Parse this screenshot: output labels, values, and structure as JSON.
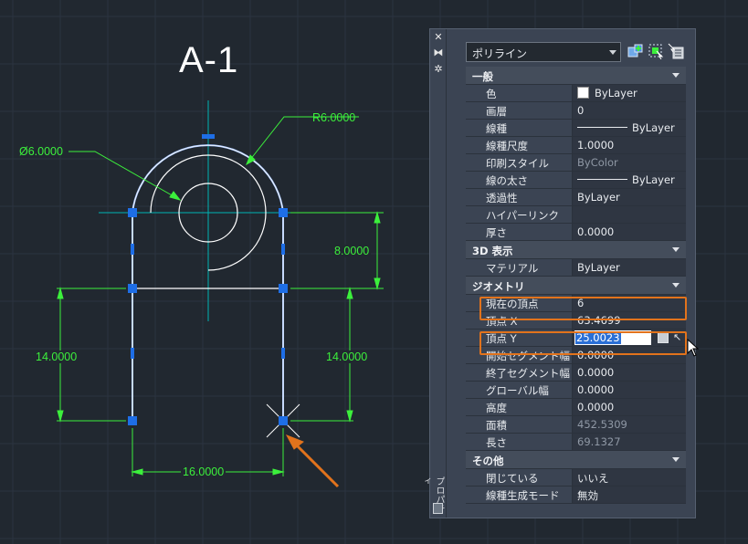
{
  "drawing": {
    "title": "A-1",
    "dimensions": {
      "radius": "R6.0000",
      "diameter": "Ø6.0000",
      "height_right_top": "8.0000",
      "height_left": "14.0000",
      "height_right": "14.0000",
      "width_bottom": "16.0000"
    }
  },
  "palette": {
    "strip": {
      "close": "✕",
      "autohide": "⧓",
      "settings": "✲",
      "title": "プロパティ"
    },
    "object_type": "ポリライン",
    "sections": {
      "general": {
        "header": "一般",
        "rows": [
          {
            "label": "色",
            "value": "ByLayer"
          },
          {
            "label": "画層",
            "value": "0"
          },
          {
            "label": "線種",
            "value": "ByLayer"
          },
          {
            "label": "線種尺度",
            "value": "1.0000"
          },
          {
            "label": "印刷スタイル",
            "value": "ByColor"
          },
          {
            "label": "線の太さ",
            "value": "ByLayer"
          },
          {
            "label": "透過性",
            "value": "ByLayer"
          },
          {
            "label": "ハイパーリンク",
            "value": ""
          },
          {
            "label": "厚さ",
            "value": "0.0000"
          }
        ]
      },
      "view3d": {
        "header": "3D 表示",
        "rows": [
          {
            "label": "マテリアル",
            "value": "ByLayer"
          }
        ]
      },
      "geometry": {
        "header": "ジオメトリ",
        "rows": [
          {
            "label": "現在の頂点",
            "value": "6"
          },
          {
            "label": "頂点 X",
            "value": "63.4699"
          },
          {
            "label": "頂点 Y",
            "value": "25.0023"
          },
          {
            "label": "開始セグメント幅",
            "value": "0.0000"
          },
          {
            "label": "終了セグメント幅",
            "value": "0.0000"
          },
          {
            "label": "グローバル幅",
            "value": "0.0000"
          },
          {
            "label": "高度",
            "value": "0.0000"
          },
          {
            "label": "面積",
            "value": "452.5309"
          },
          {
            "label": "長さ",
            "value": "69.1327"
          }
        ]
      },
      "misc": {
        "header": "その他",
        "rows": [
          {
            "label": "閉じている",
            "value": "いいえ"
          },
          {
            "label": "線種生成モード",
            "value": "無効"
          }
        ]
      }
    }
  },
  "colors": {
    "background": "#212830",
    "grid": "#2c3440",
    "geometry": "#ffffff",
    "selected_polyline": "#9fc0ff",
    "grip": "#1e6ee6",
    "dimension": "#3cf03c",
    "centerline": "#00b4b4",
    "highlight": "#e2731c"
  }
}
